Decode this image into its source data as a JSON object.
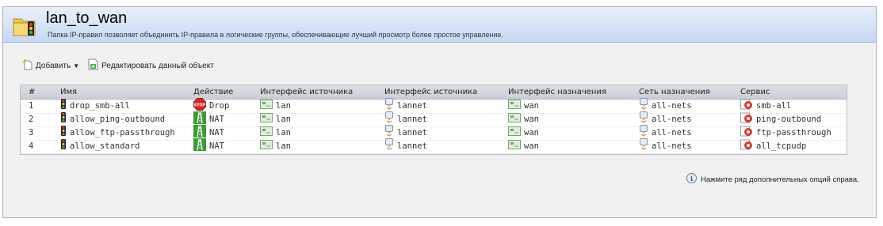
{
  "header": {
    "title": "lan_to_wan",
    "subtitle": "Папка IP-правил позволяет объединить IP-правила в логические группы, обеспечивающие лучший просмотр более простое управление."
  },
  "toolbar": {
    "add_label": "Добавить",
    "edit_label": "Редактировать данный объект"
  },
  "table": {
    "columns": [
      "#",
      "Имя",
      "Действие",
      "Интерфейс источника",
      "Интерфейс источника",
      "Интерфейс назначения",
      "Сеть назначения",
      "Сервис"
    ],
    "rows": [
      {
        "num": "1",
        "name": "drop_smb-all",
        "action": "Drop",
        "src_if": "lan",
        "src_net": "lannet",
        "dst_if": "wan",
        "dst_net": "all-nets",
        "service": "smb-all"
      },
      {
        "num": "2",
        "name": "allow_ping-outbound",
        "action": "NAT",
        "src_if": "lan",
        "src_net": "lannet",
        "dst_if": "wan",
        "dst_net": "all-nets",
        "service": "ping-outbound"
      },
      {
        "num": "3",
        "name": "allow_ftp-passthrough",
        "action": "NAT",
        "src_if": "lan",
        "src_net": "lannet",
        "dst_if": "wan",
        "dst_net": "all-nets",
        "service": "ftp-passthrough"
      },
      {
        "num": "4",
        "name": "allow_standard",
        "action": "NAT",
        "src_if": "lan",
        "src_net": "lannet",
        "dst_if": "wan",
        "dst_net": "all-nets",
        "service": "all_tcpudp"
      }
    ]
  },
  "help": {
    "text": "Нажмите ряд дополнительных опций справа."
  },
  "icons": {
    "folder": "folder-traffic-light-icon",
    "add": "add-icon",
    "edit": "edit-icon",
    "rule": "traffic-light-icon",
    "drop": "stop-sign-icon",
    "nat": "nat-road-icon",
    "interface": "interface-icon",
    "network": "network-icon",
    "service": "service-icon",
    "info": "info-icon"
  },
  "colors": {
    "header_gradient_top": "#e9f0fb",
    "header_gradient_bottom": "#c7d8f3",
    "drop_red": "#d9261c",
    "nat_green": "#3a9b35"
  }
}
